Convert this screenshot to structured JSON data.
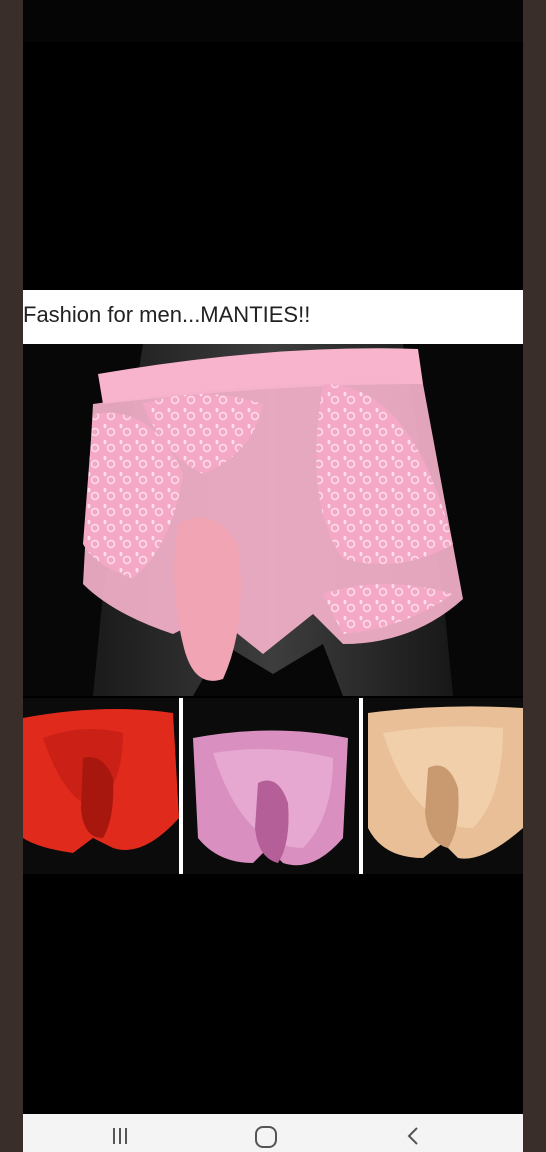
{
  "post": {
    "caption": "Fashion for men...MANTIES!!",
    "main_image_alt": "pink lace underwear on mannequin",
    "thumbnails": [
      {
        "name": "red",
        "color": "#e02a1c"
      },
      {
        "name": "lavender",
        "color": "#d98fc0"
      },
      {
        "name": "beige",
        "color": "#e9bf97"
      }
    ]
  },
  "navbar": {
    "recent_icon": "recent-apps-icon",
    "home_icon": "home-icon",
    "back_icon": "back-icon"
  },
  "colors": {
    "frame": "#3a2e2a",
    "garment_pink": "#f2a6c4"
  }
}
